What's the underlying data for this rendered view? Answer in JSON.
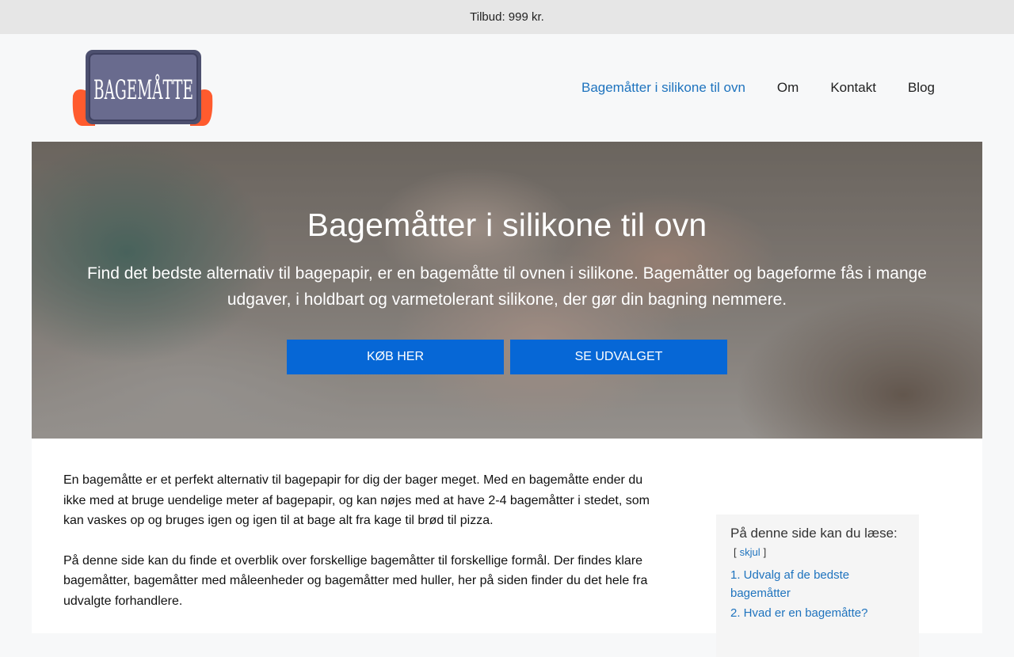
{
  "topbar": {
    "text": "Tilbud: 999 kr."
  },
  "logo": {
    "text": "BAGEMÅTTE"
  },
  "nav": [
    {
      "label": "Bagemåtter i silikone til ovn"
    },
    {
      "label": "Om"
    },
    {
      "label": "Kontakt"
    },
    {
      "label": "Blog"
    }
  ],
  "colors": {
    "accent": "#0667d6",
    "link": "#1e73be",
    "topbar_bg": "#e6e6e6"
  },
  "hero": {
    "title": "Bagemåtter i silikone til ovn",
    "text": "Find det bedste alternativ til bagepapir, er en bagemåtte til ovnen i silikone. Bagemåtter og bageforme fås i mange udgaver, i holdbart og varmetolerant silikone, der gør din bagning nemmere.",
    "buttons": [
      {
        "label": "KØB HER"
      },
      {
        "label": "SE UDVALGET"
      }
    ]
  },
  "article": {
    "paragraphs": [
      "En bagemåtte er et perfekt alternativ til bagepapir for dig der bager meget. Med en bagemåtte ender du ikke med at bruge uendelige meter af bagepapir, og kan nøjes med at have 2-4 bagemåtter i stedet, som kan vaskes op og bruges igen og igen til at bage alt fra kage til brød til pizza.",
      "På denne side kan du finde et overblik over forskellige bagemåtter til forskellige formål. Der findes klare bagemåtter, bagemåtter med måleenheder og bagemåtter med huller, her på siden finder du det hele fra udvalgte forhandlere."
    ]
  },
  "toc": {
    "title": "På denne side kan du læse:",
    "bracket_open": "[",
    "toggle": "skjul",
    "bracket_close": "]",
    "items": [
      {
        "label": "1. Udvalg af de bedste bagemåtter"
      },
      {
        "label": "2. Hvad er en bagemåtte?"
      }
    ]
  }
}
